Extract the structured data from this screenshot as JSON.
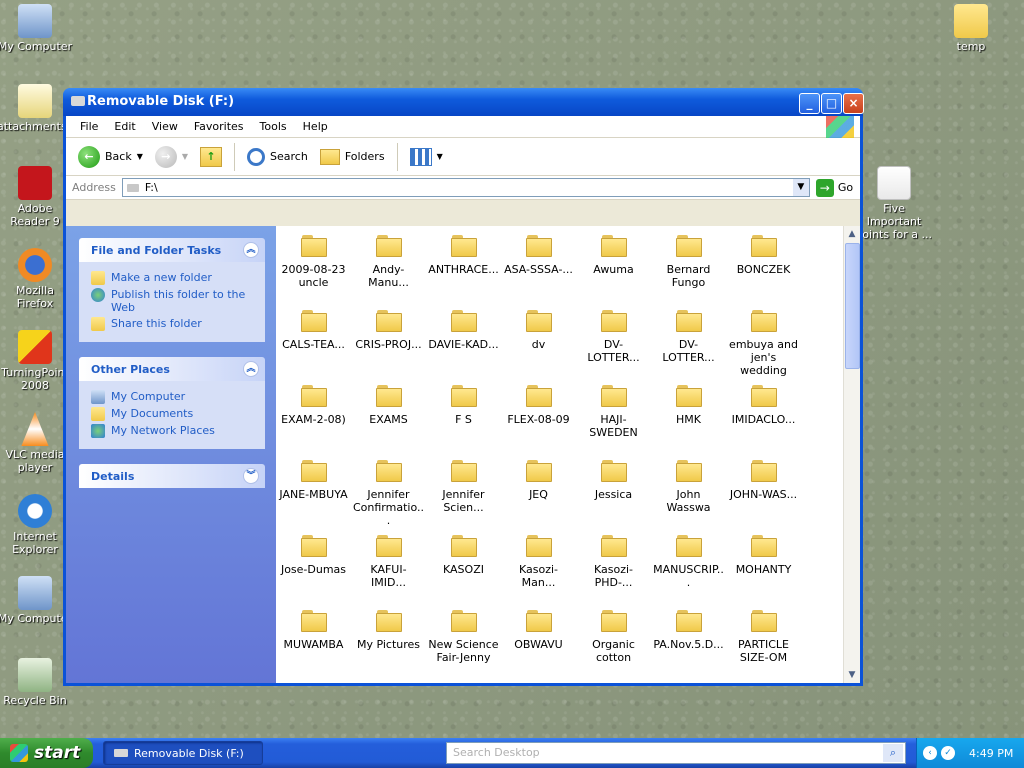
{
  "desktop": {
    "left_icons": [
      {
        "label": "My Computer"
      },
      {
        "label": "attachments..."
      },
      {
        "label": "Adobe Reader 9"
      },
      {
        "label": "Mozilla Firefox"
      },
      {
        "label": "TurningPoint 2008"
      },
      {
        "label": "VLC media player"
      },
      {
        "label": "Internet Explorer"
      },
      {
        "label": "My Computer"
      },
      {
        "label": "Recycle Bin"
      }
    ],
    "right_icons": [
      {
        "label": "temp"
      },
      {
        "label": "Five Important Points for a ..."
      }
    ]
  },
  "window": {
    "title": "Removable Disk (F:)",
    "menu": [
      "File",
      "Edit",
      "View",
      "Favorites",
      "Tools",
      "Help"
    ],
    "toolbar": {
      "back": "Back",
      "search": "Search",
      "folders": "Folders"
    },
    "address": {
      "label": "Address",
      "value": "F:\\",
      "go": "Go"
    },
    "tasks": {
      "file_folder_tasks": {
        "title": "File and Folder Tasks",
        "links": [
          "Make a new folder",
          "Publish this folder to the Web",
          "Share this folder"
        ]
      },
      "other_places": {
        "title": "Other Places",
        "links": [
          "My Computer",
          "My Documents",
          "My Network Places"
        ]
      },
      "details": {
        "title": "Details"
      }
    },
    "files": [
      "2009-08-23 uncle",
      "Andy-Manu...",
      "ANTHRACE...",
      "ASA-SSSA-...",
      "Awuma",
      "Bernard Fungo",
      "BONCZEK",
      "CALS-TEA...",
      "CRIS-PROJ...",
      "DAVIE-KAD...",
      "dv",
      "DV-LOTTER...",
      "DV-LOTTER...",
      "embuya and jen's wedding",
      "EXAM-2-08)",
      "EXAMS",
      "F S",
      "FLEX-08-09",
      "HAJI-SWEDEN",
      "HMK",
      "IMIDACLO...",
      "JANE-MBUYA",
      "Jennifer Confirmatio...",
      "Jennifer Scien...",
      "JEQ",
      "Jessica",
      "John Wasswa",
      "JOHN-WAS...",
      "Jose-Dumas",
      "KAFUI-IMID...",
      "KASOZI",
      "Kasozi-Man...",
      "Kasozi-PHD-...",
      "MANUSCRIP...",
      "MOHANTY",
      "MUWAMBA",
      "My Pictures",
      "New Science Fair-Jenny",
      "OBWAVU",
      "Organic cotton",
      "PA.Nov.5.D...",
      "PARTICLE SIZE-OM",
      "",
      "",
      "",
      "",
      "",
      "",
      ""
    ]
  },
  "taskbar": {
    "start": "start",
    "task_item": "Removable Disk (F:)",
    "search_placeholder": "Search Desktop",
    "clock": "4:49 PM"
  }
}
